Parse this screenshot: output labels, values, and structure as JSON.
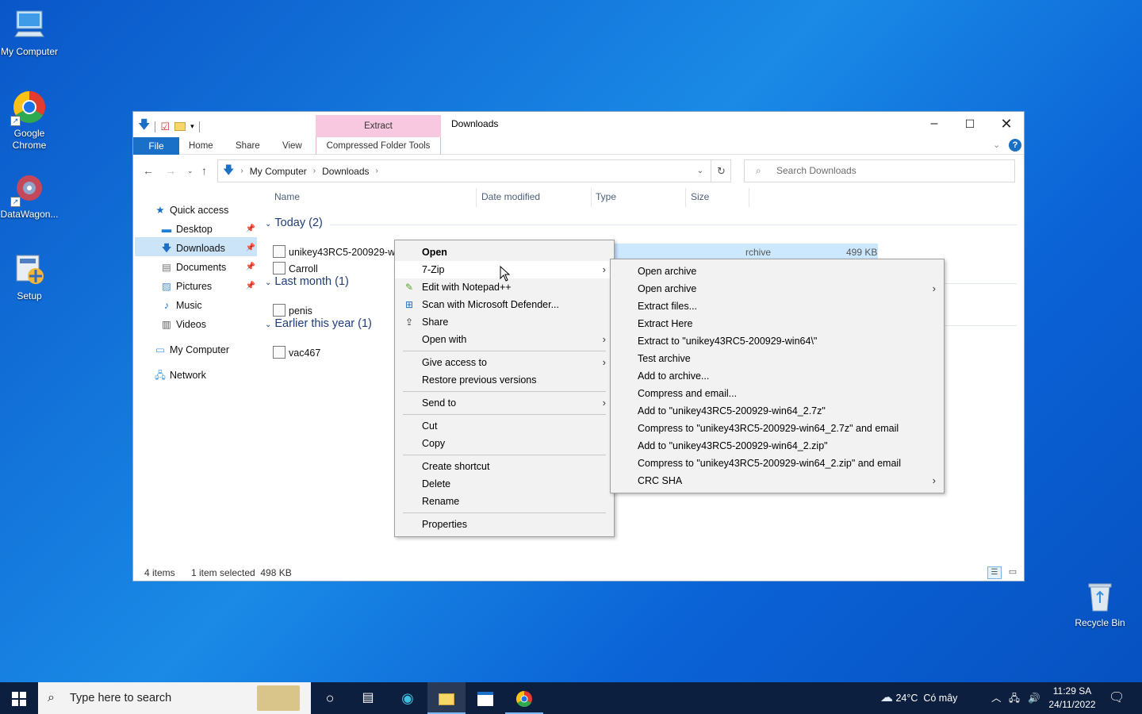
{
  "desktop": {
    "icons": [
      {
        "label": "My Computer"
      },
      {
        "label": "Google Chrome"
      },
      {
        "label": "DataWagon..."
      },
      {
        "label": "Setup"
      },
      {
        "label": "Recycle Bin"
      }
    ]
  },
  "window": {
    "title": "Downloads",
    "contextual_tab": "Extract",
    "ribbon": {
      "file": "File",
      "home": "Home",
      "share": "Share",
      "view": "View",
      "compressed_tools": "Compressed Folder Tools"
    },
    "address": {
      "parts": [
        "My Computer",
        "Downloads"
      ]
    },
    "search_placeholder": "Search Downloads",
    "nav": {
      "quick_access": "Quick access",
      "desktop": "Desktop",
      "downloads": "Downloads",
      "documents": "Documents",
      "pictures": "Pictures",
      "music": "Music",
      "videos": "Videos",
      "my_computer": "My Computer",
      "network": "Network"
    },
    "columns": {
      "name": "Name",
      "date": "Date modified",
      "type": "Type",
      "size": "Size"
    },
    "groups": {
      "today": "Today (2)",
      "last_month": "Last month (1)",
      "earlier": "Earlier this year (1)"
    },
    "files": {
      "f1": {
        "name": "unikey43RC5-200929-win",
        "type": "rchive",
        "size": "499 KB"
      },
      "f2": {
        "name": "Carroll"
      },
      "f3": {
        "name": "penis"
      },
      "f4": {
        "name": "vac467"
      }
    },
    "status": {
      "items": "4 items",
      "selected": "1 item selected  498 KB"
    }
  },
  "context_menu": {
    "open": "Open",
    "zip": "7-Zip",
    "notepad": "Edit with Notepad++",
    "defender": "Scan with Microsoft Defender...",
    "share": "Share",
    "open_with": "Open with",
    "give_access": "Give access to",
    "restore": "Restore previous versions",
    "send_to": "Send to",
    "cut": "Cut",
    "copy": "Copy",
    "create_shortcut": "Create shortcut",
    "delete": "Delete",
    "rename": "Rename",
    "properties": "Properties"
  },
  "zip_submenu": {
    "open_archive": "Open archive",
    "open_archive2": "Open archive",
    "extract_files": "Extract files...",
    "extract_here": "Extract Here",
    "extract_to": "Extract to \"unikey43RC5-200929-win64\\\"",
    "test": "Test archive",
    "add": "Add to archive...",
    "compress_email": "Compress and email...",
    "add_7z": "Add to \"unikey43RC5-200929-win64_2.7z\"",
    "compress_7z_email": "Compress to \"unikey43RC5-200929-win64_2.7z\" and email",
    "add_zip": "Add to \"unikey43RC5-200929-win64_2.zip\"",
    "compress_zip_email": "Compress to \"unikey43RC5-200929-win64_2.zip\" and email",
    "crc": "CRC SHA"
  },
  "taskbar": {
    "search_placeholder": "Type here to search",
    "weather": "24°C  Có mây",
    "time": "11:29 SA",
    "date": "24/11/2022"
  }
}
